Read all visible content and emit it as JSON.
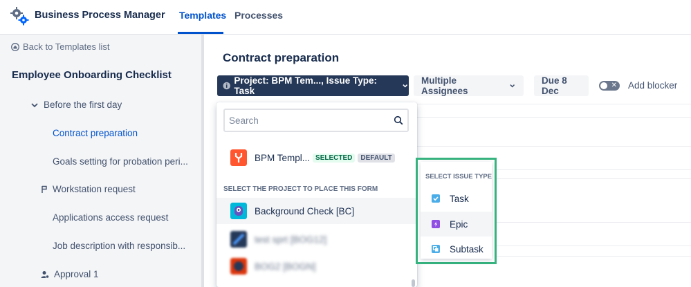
{
  "header": {
    "app_title": "Business Process Manager",
    "tabs": [
      {
        "label": "Templates",
        "active": true
      },
      {
        "label": "Processes",
        "active": false
      }
    ]
  },
  "sidebar": {
    "back_link": "Back to Templates list",
    "checklist_title": "Employee Onboarding Checklist",
    "items": [
      {
        "label": "Before the first day",
        "icon": "chevron-down-icon"
      },
      {
        "label": "Contract preparation",
        "active": true
      },
      {
        "label": "Goals setting for probation peri..."
      },
      {
        "label": "Workstation request",
        "icon": "flag-icon"
      },
      {
        "label": "Applications access request"
      },
      {
        "label": "Job description with responsib..."
      },
      {
        "label": "Approval 1",
        "icon": "user-approval-icon"
      }
    ]
  },
  "main": {
    "title": "Contract preparation",
    "project_button": "Project: BPM Tem..., Issue Type: Task",
    "assignees_button": "Multiple Assignees",
    "due_button": "Due 8 Dec",
    "blocker_label": "Add blocker"
  },
  "dropdown": {
    "search_placeholder": "Search",
    "selected_project": {
      "label": "BPM Templ...",
      "badge_selected": "SELECTED",
      "badge_default": "DEFAULT"
    },
    "group_header": "SELECT THE PROJECT TO PLACE THIS FORM",
    "projects": [
      {
        "label": "Background Check [BC]"
      },
      {
        "label": "test sprt [BOG12]"
      },
      {
        "label": "BOG2 [BOGN]"
      }
    ]
  },
  "issue_type_menu": {
    "header": "SELECT ISSUE TYPE",
    "options": [
      {
        "label": "Task",
        "icon": "task-icon",
        "color": "#4bade8"
      },
      {
        "label": "Epic",
        "icon": "epic-icon",
        "color": "#904ee2"
      },
      {
        "label": "Subtask",
        "icon": "subtask-icon",
        "color": "#4bade8"
      }
    ]
  },
  "colors": {
    "accent": "#0052cc",
    "dark_button": "#253858",
    "highlight_border": "#36b37e"
  }
}
